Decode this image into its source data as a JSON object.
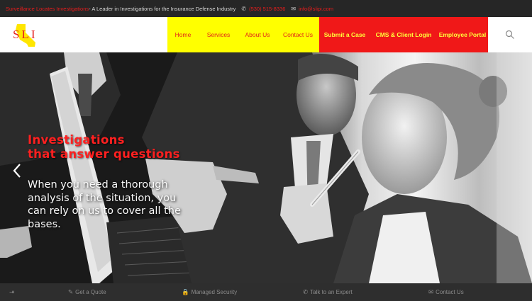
{
  "topbar": {
    "brand": "Surveillance Locates Investigations",
    "tagline": " - A Leader in Investigations for the Insurance Defense Industry",
    "phone": "(530) 515-8336",
    "email": "info@slipi.com"
  },
  "logo": {
    "text": "SLI"
  },
  "nav": {
    "home": "Home",
    "services": "Services",
    "about": "About Us",
    "contact": "Contact Us",
    "submit": "Submit a Case",
    "cms": "CMS & Client Login",
    "employee": "Employee Portal"
  },
  "hero": {
    "title_line1": "Investigations",
    "title_line2": "that answer questions",
    "subtitle": "When you need a thorough analysis of the situation, you can rely on us to cover all the bases."
  },
  "bottombar": {
    "quote": "Get a Quote",
    "security": "Managed Security",
    "expert": "Talk to an Expert",
    "contact": "Contact Us"
  },
  "colors": {
    "nav_yellow": "#ffff00",
    "nav_red": "#f01818",
    "brand_red": "#e2231a"
  },
  "icons": [
    "phone-icon",
    "mail-icon",
    "search-icon",
    "chevron-left-icon",
    "login-icon",
    "quote-icon",
    "lock-icon",
    "phone-icon",
    "chat-icon"
  ]
}
